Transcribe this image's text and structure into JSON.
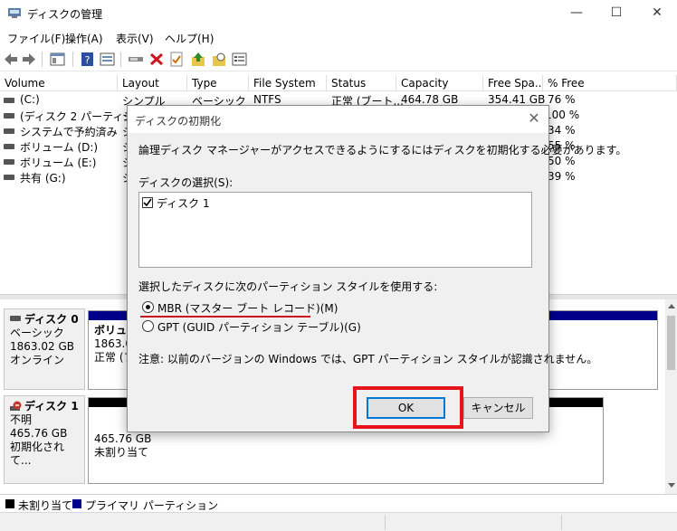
{
  "window": {
    "title": "ディスクの管理",
    "controls": {
      "minimize": "—",
      "maximize": "☐",
      "close": "✕"
    }
  },
  "menu": [
    "ファイル(F)",
    "操作(A)",
    "表示(V)",
    "ヘルプ(H)"
  ],
  "toolbar": [
    "back-icon",
    "forward-icon",
    "properties-icon",
    "help-icon",
    "view-icon",
    "connect-icon",
    "delete-icon",
    "check-icon",
    "up-icon",
    "search-icon",
    "list-icon"
  ],
  "volume_table": {
    "headers": [
      "Volume",
      "Layout",
      "Type",
      "File System",
      "Status",
      "Capacity",
      "Free Spa...",
      "% Free"
    ],
    "rows": [
      {
        "volume": "(C:)",
        "layout": "シンプル",
        "type": "ベーシック",
        "fs": "NTFS",
        "status": "正常 (ブート...",
        "capacity": "464.78 GB",
        "free": "354.41 GB",
        "pct": "76 %"
      },
      {
        "volume": "(ディスク 2 パーティシ",
        "layout": "シ",
        "type": "",
        "fs": "",
        "status": "",
        "capacity": "",
        "free": "",
        "pct": "100 %"
      },
      {
        "volume": "システムで予約済み",
        "layout": "シ",
        "type": "",
        "fs": "",
        "status": "",
        "capacity": "",
        "free": "",
        "pct": "34 %"
      },
      {
        "volume": "ボリューム (D:)",
        "layout": "シ",
        "type": "",
        "fs": "",
        "status": "",
        "capacity": "",
        "free": "",
        "pct": "55 %"
      },
      {
        "volume": "ボリューム (E:)",
        "layout": "シ",
        "type": "",
        "fs": "",
        "status": "",
        "capacity": "",
        "free": "",
        "pct": "50 %"
      },
      {
        "volume": "共有 (G:)",
        "layout": "シ",
        "type": "",
        "fs": "",
        "status": "",
        "capacity": "",
        "free": "",
        "pct": "39 %"
      }
    ]
  },
  "disks": [
    {
      "name": "ディスク 0",
      "type": "ベーシック",
      "size": "1863.02 GB",
      "state": "オンライン",
      "partition": {
        "label": "ボリュー",
        "size": "1863.0",
        "status": "正常 (フ"
      }
    },
    {
      "name": "ディスク 1",
      "type": "不明",
      "size": "465.76 GB",
      "state": "初期化されて...",
      "partition": {
        "size": "465.76 GB",
        "status": "未割り当て"
      }
    }
  ],
  "legend": {
    "unallocated": "未割り当て",
    "primary": "プライマリ パーティション"
  },
  "colors": {
    "primary": "#00008b",
    "unallocated": "#000000",
    "highlight": "#e8141c",
    "disk_error": "#c0392b"
  },
  "dialog": {
    "title": "ディスクの初期化",
    "intro": "論理ディスク マネージャーがアクセスできるようにするにはディスクを初期化する必要があります。",
    "select_label": "ディスクの選択(S):",
    "disk_item": "ディスク 1",
    "style_label": "選択したディスクに次のパーティション スタイルを使用する:",
    "mbr": "MBR (マスター ブート レコード)(M)",
    "gpt": "GPT (GUID パーティション テーブル)(G)",
    "note": "注意: 以前のバージョンの Windows では、GPT パーティション スタイルが認識されません。",
    "ok": "OK",
    "cancel": "キャンセル"
  }
}
